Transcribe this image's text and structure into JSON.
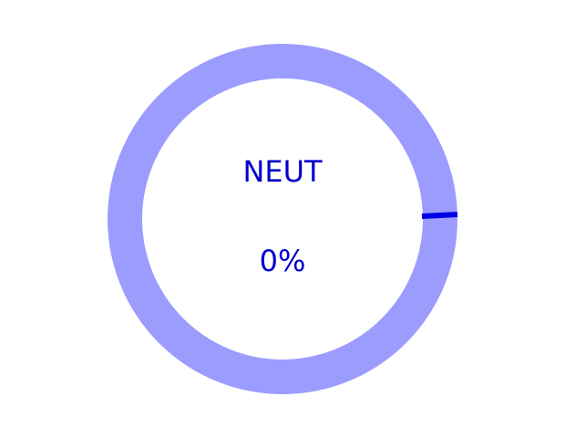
{
  "gauge": {
    "label": "NEUT",
    "percent_text": "0%",
    "fraction": 0.0,
    "colors": {
      "track": "#9c9cff",
      "progress": "#0000e6",
      "text": "#0000cc"
    }
  }
}
